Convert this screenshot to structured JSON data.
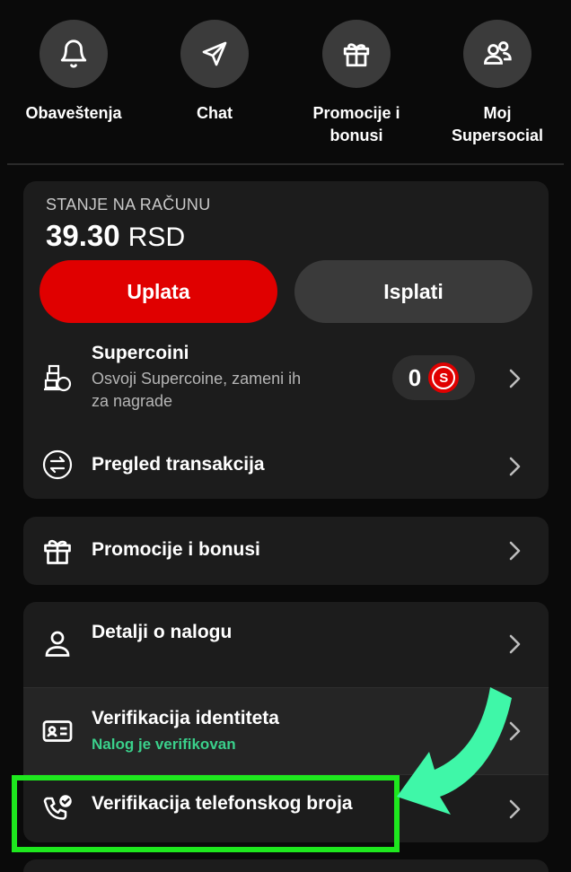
{
  "quick_actions": [
    {
      "label": "Obaveštenja",
      "icon": "bell-icon"
    },
    {
      "label": "Chat",
      "icon": "send-icon"
    },
    {
      "label_line1": "Promocije i",
      "label_line2": "bonusi",
      "icon": "gift-icon"
    },
    {
      "label_line1": "Moj",
      "label_line2": "Supersocial",
      "icon": "users-icon"
    }
  ],
  "balance": {
    "label": "STANJE NA RAČUNU",
    "amount": "39.30",
    "currency": "RSD",
    "deposit_label": "Uplata",
    "withdraw_label": "Isplati"
  },
  "supercoins": {
    "title": "Supercoini",
    "subtitle_line1": "Osvoji Supercoine, zameni ih",
    "subtitle_line2": "za nagrade",
    "count": "0",
    "coin_glyph": "S"
  },
  "transactions": {
    "title": "Pregled transakcija"
  },
  "promotions": {
    "title": "Promocije i bonusi"
  },
  "account": {
    "title": "Detalji o nalogu"
  },
  "identity": {
    "title": "Verifikacija identiteta",
    "status": "Nalog je verifikovan"
  },
  "phone": {
    "title": "Verifikacija telefonskog broja"
  },
  "colors": {
    "accent": "#e00000",
    "verified": "#3ad08b",
    "highlight": "#1ee81e",
    "arrow": "#3ff7a8"
  }
}
